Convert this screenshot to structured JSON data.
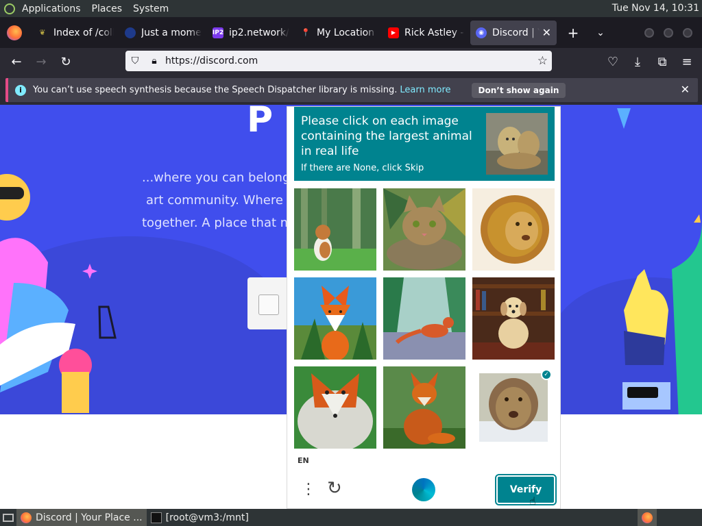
{
  "panel": {
    "menus": [
      "Applications",
      "Places",
      "System"
    ],
    "clock": "Tue Nov 14, 10:31"
  },
  "tabs": [
    {
      "label": "Index of /colle",
      "icon": "leaf-icon"
    },
    {
      "label": "Just a moment",
      "icon": "globe-icon"
    },
    {
      "label": "ip2.network/",
      "icon": "ip2-icon"
    },
    {
      "label": "My Location",
      "icon": "location-pin-icon"
    },
    {
      "label": "Rick Astley - N",
      "icon": "youtube-icon"
    },
    {
      "label": "Discord | Yo",
      "icon": "discord-icon",
      "active": true
    }
  ],
  "nav": {
    "url": "https://discord.com"
  },
  "notification": {
    "message": "You can’t use speech synthesis because the Speech Dispatcher library is missing.",
    "learn_more": "Learn more",
    "dont_show": "Don’t show again"
  },
  "hero": {
    "title": "P",
    "lines": [
      "...where you can belong t",
      "art community. Where ju",
      "together. A place that ma"
    ]
  },
  "captcha": {
    "prompt": "Please click on each image containing the largest animal in real life",
    "subprompt": "If there are None, click Skip",
    "cells": [
      {
        "subject": "cat in forest",
        "selected": false
      },
      {
        "subject": "tabby cat",
        "selected": false
      },
      {
        "subject": "lion",
        "selected": false
      },
      {
        "subject": "fox",
        "selected": false
      },
      {
        "subject": "fox on path",
        "selected": false
      },
      {
        "subject": "dog by bookshelf",
        "selected": false
      },
      {
        "subject": "fox portrait",
        "selected": false
      },
      {
        "subject": "fox sitting",
        "selected": false
      },
      {
        "subject": "lioness",
        "selected": true
      }
    ],
    "language": "EN",
    "verify_label": "Verify",
    "accent": "#00838f"
  },
  "taskbar": {
    "items": [
      {
        "label": "Discord | Your Place ..."
      },
      {
        "label": "[root@vm3:/mnt]"
      }
    ]
  }
}
